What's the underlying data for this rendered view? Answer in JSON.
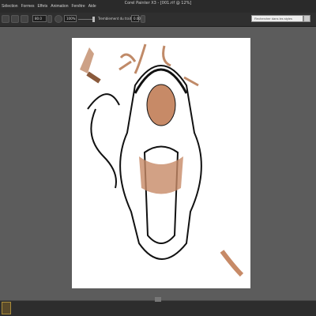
{
  "app": {
    "title": "Corel Painter X3 - [001.rif @ 12%]"
  },
  "menubar": {
    "items": [
      "Sélection",
      "Formes",
      "Effets",
      "Animation",
      "Fenêtre",
      "Aide"
    ]
  },
  "toolbar": {
    "size_value": "80.0",
    "opacity_value": "100%",
    "tremor_label": "Tremblement du trait :",
    "tremor_value": "0.00"
  },
  "search": {
    "placeholder": "Rechercher dans les styles"
  },
  "colors": {
    "menubar_bg": "#2a2a2a",
    "toolbar_bg": "#2f2f2f",
    "workspace_bg": "#5c5c5c",
    "canvas_bg": "#ffffff",
    "stroke_accent": "#c08a68"
  }
}
